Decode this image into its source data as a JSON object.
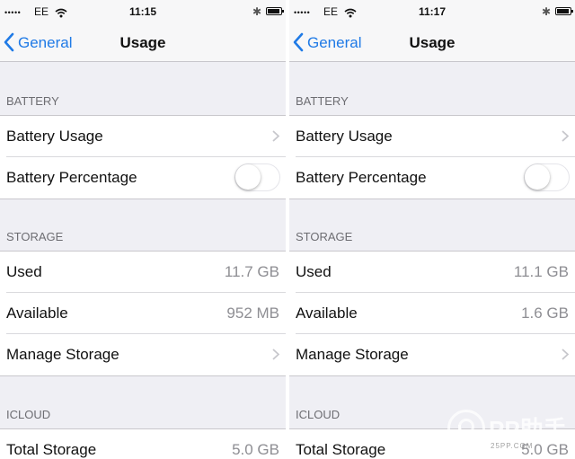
{
  "panels": [
    {
      "status": {
        "signal": "•••••",
        "carrier": "EE",
        "time": "11:15",
        "bluetooth": "✱",
        "battery_level": 0.9
      },
      "nav": {
        "back_label": "General",
        "title": "Usage"
      },
      "battery": {
        "header": "BATTERY",
        "usage_label": "Battery Usage",
        "percentage_label": "Battery Percentage",
        "percentage_on": false
      },
      "storage": {
        "header": "STORAGE",
        "used_label": "Used",
        "used_value": "11.7 GB",
        "available_label": "Available",
        "available_value": "952 MB",
        "manage_label": "Manage Storage"
      },
      "icloud": {
        "header": "ICLOUD",
        "total_label": "Total Storage",
        "total_value": "5.0 GB"
      }
    },
    {
      "status": {
        "signal": "•••••",
        "carrier": "EE",
        "time": "11:17",
        "bluetooth": "✱",
        "battery_level": 0.9
      },
      "nav": {
        "back_label": "General",
        "title": "Usage"
      },
      "battery": {
        "header": "BATTERY",
        "usage_label": "Battery Usage",
        "percentage_label": "Battery Percentage",
        "percentage_on": false
      },
      "storage": {
        "header": "STORAGE",
        "used_label": "Used",
        "used_value": "11.1 GB",
        "available_label": "Available",
        "available_value": "1.6 GB",
        "manage_label": "Manage Storage"
      },
      "icloud": {
        "header": "ICLOUD",
        "total_label": "Total Storage",
        "total_value": "5.0 GB"
      }
    }
  ],
  "watermark": {
    "brand": "PP助手",
    "sub": "25PP.COM"
  },
  "colors": {
    "accent": "#1f7ae6",
    "background": "#efeff4",
    "secondary_text": "#8e8e93",
    "section_header": "#6d6d72"
  },
  "icons": {
    "back": "chevron-left-icon",
    "disclosure": "chevron-right-icon",
    "wifi": "wifi-icon",
    "bluetooth": "bluetooth-icon",
    "battery": "battery-icon"
  }
}
